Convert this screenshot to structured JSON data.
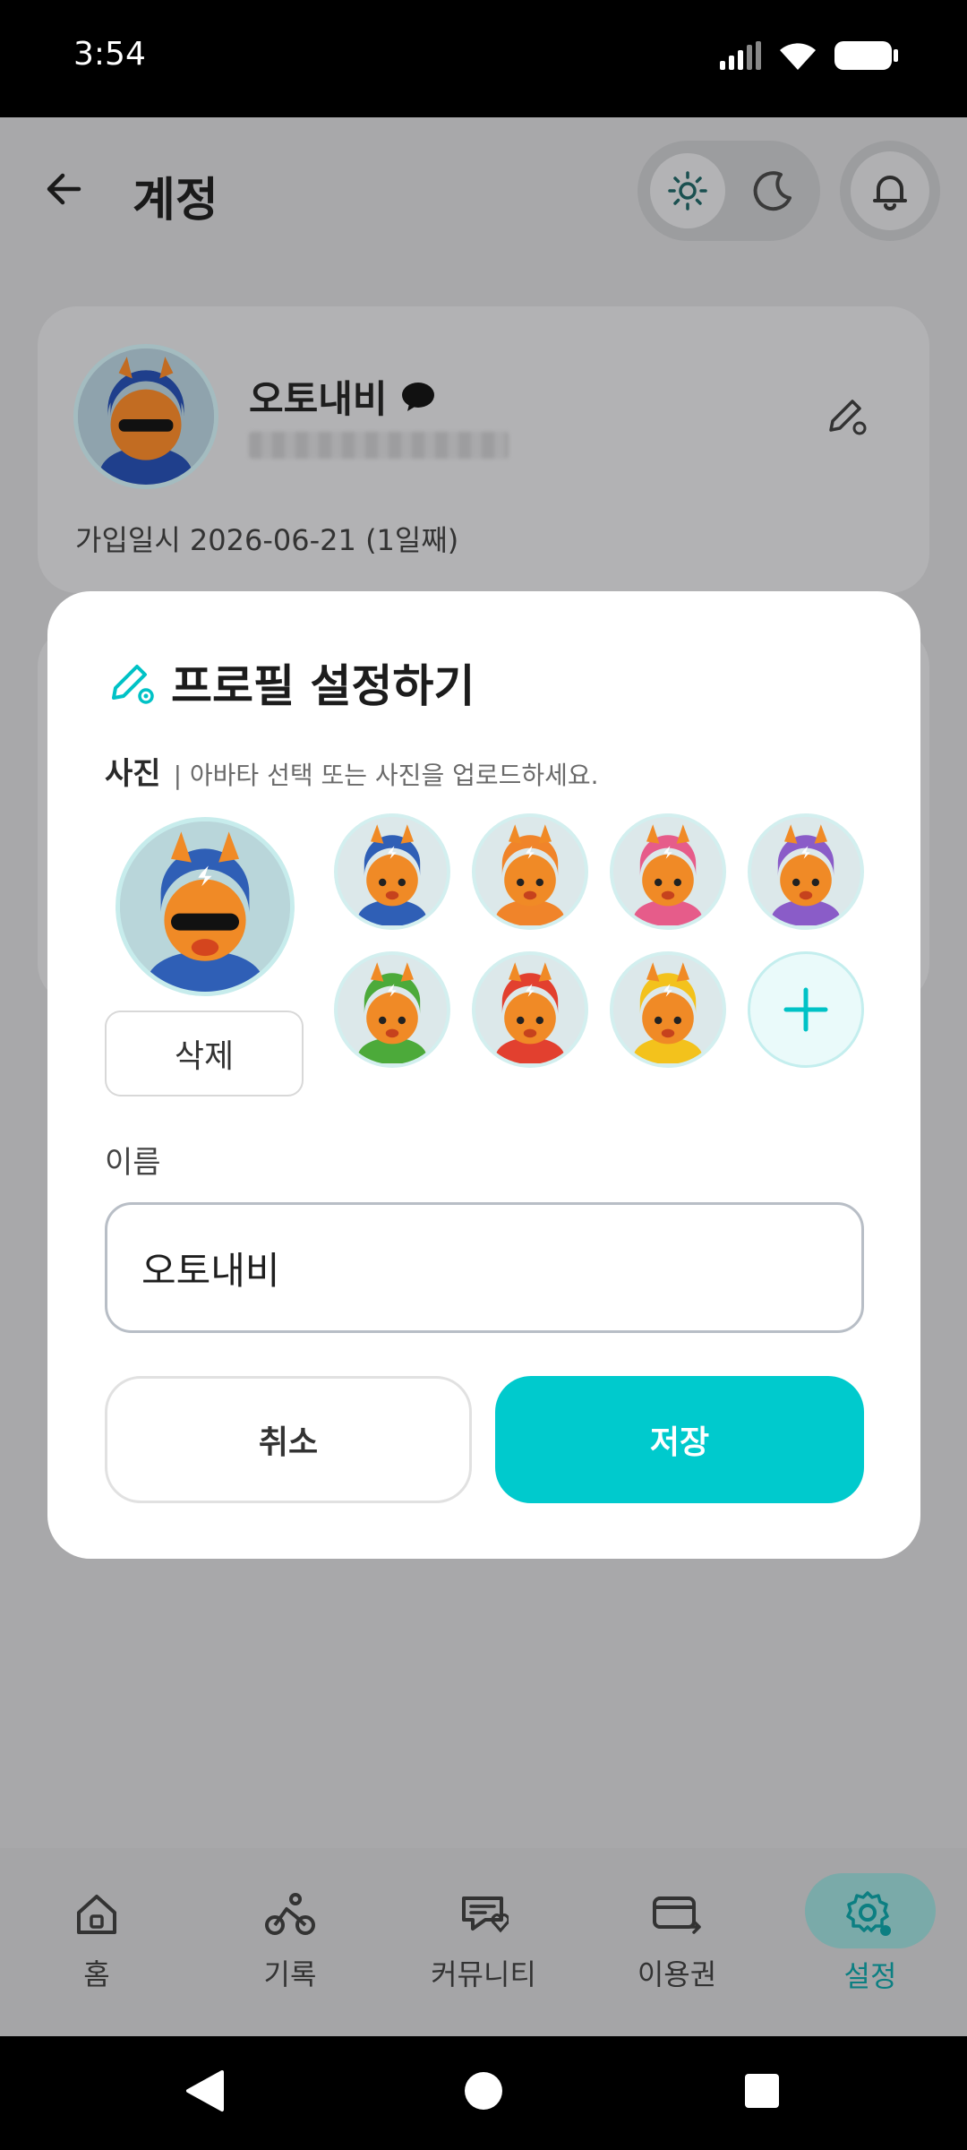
{
  "status_bar": {
    "time": "3:54"
  },
  "app_bar": {
    "title": "계정"
  },
  "profile": {
    "name": "오토내비",
    "joined": "가입일시 2026-06-21 (1일째)"
  },
  "modal": {
    "title": "프로필 설정하기",
    "photo_label": "사진",
    "photo_hint": "| 아바타 선택 또는 사진을 업로드하세요.",
    "delete_label": "삭제",
    "name_label": "이름",
    "name_value": "오토내비",
    "cancel_label": "취소",
    "save_label": "저장",
    "avatars": [
      {
        "helmet": "#2f5fb6",
        "face": "#f08a26",
        "label": "blue"
      },
      {
        "helmet": "#f0842a",
        "face": "#f08a26",
        "label": "orange"
      },
      {
        "helmet": "#e65c8a",
        "face": "#f08a26",
        "label": "pink"
      },
      {
        "helmet": "#8a5cc8",
        "face": "#f08a26",
        "label": "purple"
      },
      {
        "helmet": "#4caa3a",
        "face": "#f08a26",
        "label": "green"
      },
      {
        "helmet": "#e2402f",
        "face": "#f08a26",
        "label": "red"
      },
      {
        "helmet": "#f3c21c",
        "face": "#f08a26",
        "label": "yellow"
      }
    ],
    "accent": "#00cacd"
  },
  "bottom_nav": {
    "items": [
      {
        "label": "홈",
        "icon": "home-icon"
      },
      {
        "label": "기록",
        "icon": "bike-icon"
      },
      {
        "label": "커뮤니티",
        "icon": "community-icon"
      },
      {
        "label": "이용권",
        "icon": "ticket-icon"
      },
      {
        "label": "설정",
        "icon": "settings-icon",
        "active": true
      }
    ]
  }
}
